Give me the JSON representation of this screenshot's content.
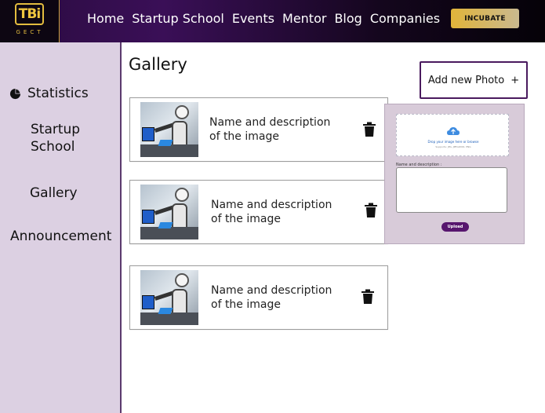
{
  "brand": {
    "logo_text": "TBi",
    "logo_sub": "GECT"
  },
  "nav": {
    "items": [
      "Home",
      "Startup School",
      "Events",
      "Mentor",
      "Blog",
      "Companies"
    ],
    "cta_label": "INCUBATE"
  },
  "sidebar": {
    "items": [
      {
        "label": "Statistics",
        "icon": "pie-chart-icon"
      },
      {
        "label": "Startup School"
      },
      {
        "label": "Gallery"
      },
      {
        "label": "Announcement"
      }
    ]
  },
  "main": {
    "title": "Gallery",
    "add_button_label": "Add new Photo",
    "add_button_icon": "+",
    "cards": [
      {
        "description": "Name and description of the image",
        "icon": "trash-icon"
      },
      {
        "description": "Name and description of the image",
        "icon": "trash-icon"
      },
      {
        "description": "Name and description of the image",
        "icon": "trash-icon"
      }
    ]
  },
  "upload": {
    "dropzone_text": "Drop your image here or browse",
    "dropzone_subtext": "Supports: JPG, JPEG2000, PNG",
    "field_label": "Name and description :",
    "button_label": "Upload"
  },
  "colors": {
    "accent": "#57166e",
    "sidebar_bg": "#dcd0e2",
    "cta_gold": "#e1b43a"
  }
}
